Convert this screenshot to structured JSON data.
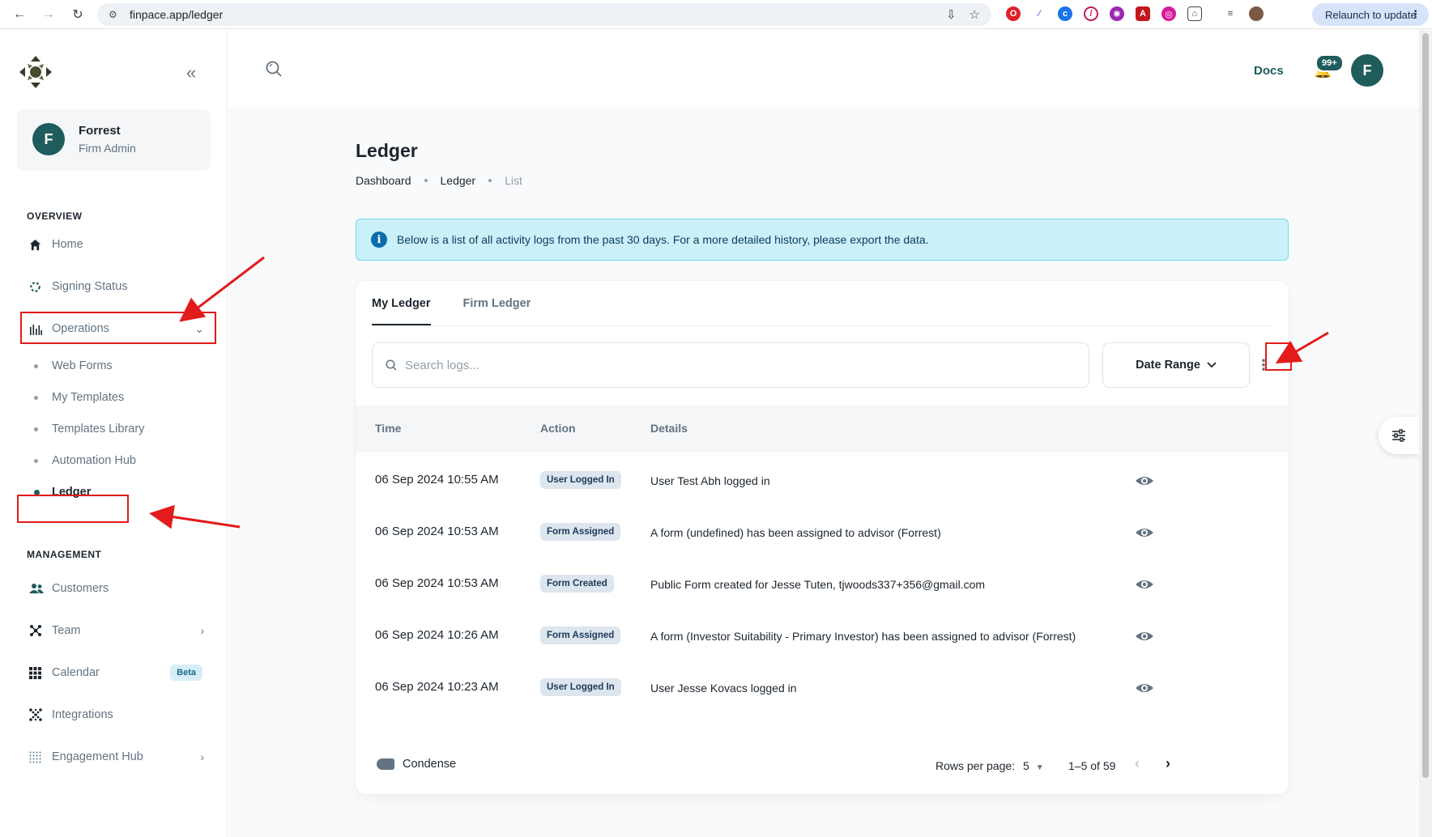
{
  "browser": {
    "url": "finpace.app/ledger",
    "relaunch_label": "Relaunch to update"
  },
  "sidebar": {
    "user": {
      "initial": "F",
      "name": "Forrest",
      "role": "Firm Admin"
    },
    "overview_label": "OVERVIEW",
    "management_label": "MANAGEMENT",
    "overview_items": [
      {
        "label": "Home",
        "icon": "home-icon"
      },
      {
        "label": "Signing Status",
        "icon": "spinner-icon"
      },
      {
        "label": "Operations",
        "icon": "bar-chart-icon"
      }
    ],
    "operations_sub": [
      {
        "label": "Web Forms"
      },
      {
        "label": "My Templates"
      },
      {
        "label": "Templates Library"
      },
      {
        "label": "Automation Hub"
      },
      {
        "label": "Ledger"
      }
    ],
    "management_items": [
      {
        "label": "Customers",
        "icon": "users-icon"
      },
      {
        "label": "Team",
        "icon": "team-icon"
      },
      {
        "label": "Calendar",
        "icon": "grid-icon",
        "badge": "Beta"
      },
      {
        "label": "Integrations",
        "icon": "dots-icon"
      },
      {
        "label": "Engagement Hub",
        "icon": "dots-grid-icon"
      }
    ]
  },
  "header": {
    "docs_label": "Docs",
    "notification_count": "99+",
    "avatar_initial": "F"
  },
  "page": {
    "title": "Ledger",
    "breadcrumb": [
      "Dashboard",
      "Ledger",
      "List"
    ],
    "alert": "Below is a list of all activity logs from the past 30 days. For a more detailed history, please export the data."
  },
  "ledger": {
    "tabs": [
      "My Ledger",
      "Firm Ledger"
    ],
    "search_placeholder": "Search logs...",
    "date_range_label": "Date Range",
    "columns": [
      "Time",
      "Action",
      "Details"
    ],
    "rows": [
      {
        "time": "06 Sep 2024 10:55 AM",
        "action": "User Logged In",
        "details": "User Test Abh logged in"
      },
      {
        "time": "06 Sep 2024 10:53 AM",
        "action": "Form Assigned",
        "details": "A form (undefined) has been assigned to advisor (Forrest)"
      },
      {
        "time": "06 Sep 2024 10:53 AM",
        "action": "Form Created",
        "details": "Public Form created for Jesse Tuten, tjwoods337+356@gmail.com"
      },
      {
        "time": "06 Sep 2024 10:26 AM",
        "action": "Form Assigned",
        "details": "A form (Investor Suitability - Primary Investor) has been assigned to advisor (Forrest)"
      },
      {
        "time": "06 Sep 2024 10:23 AM",
        "action": "User Logged In",
        "details": "User Jesse Kovacs logged in"
      }
    ],
    "condense_label": "Condense",
    "rows_per_page_label": "Rows per page:",
    "rows_per_page": "5",
    "page_info": "1–5 of 59"
  },
  "colors": {
    "brand": "#1f5c5c",
    "annotation": "#e21b1b",
    "alert_bg": "#caf0fa"
  }
}
